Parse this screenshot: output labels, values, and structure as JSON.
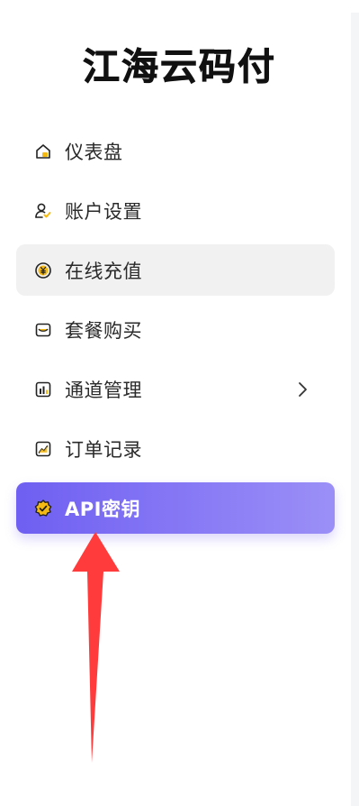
{
  "brand": {
    "title": "江海云码付"
  },
  "menu": {
    "items": [
      {
        "label": "仪表盘",
        "icon": "dashboard-icon"
      },
      {
        "label": "账户设置",
        "icon": "user-settings-icon"
      },
      {
        "label": "在线充值",
        "icon": "yuan-coin-icon"
      },
      {
        "label": "套餐购买",
        "icon": "package-icon"
      },
      {
        "label": "通道管理",
        "icon": "bar-chart-icon"
      },
      {
        "label": "订单记录",
        "icon": "line-chart-icon"
      },
      {
        "label": "API密钥",
        "icon": "api-badge-icon"
      }
    ],
    "hover_index": 2,
    "active_index": 6,
    "expandable_index": 4
  },
  "colors": {
    "active_gradient_start": "#6f5ff2",
    "active_gradient_end": "#9b8ff7",
    "accent_yellow": "#f5b914",
    "annotation_arrow": "#ff3b3b"
  }
}
